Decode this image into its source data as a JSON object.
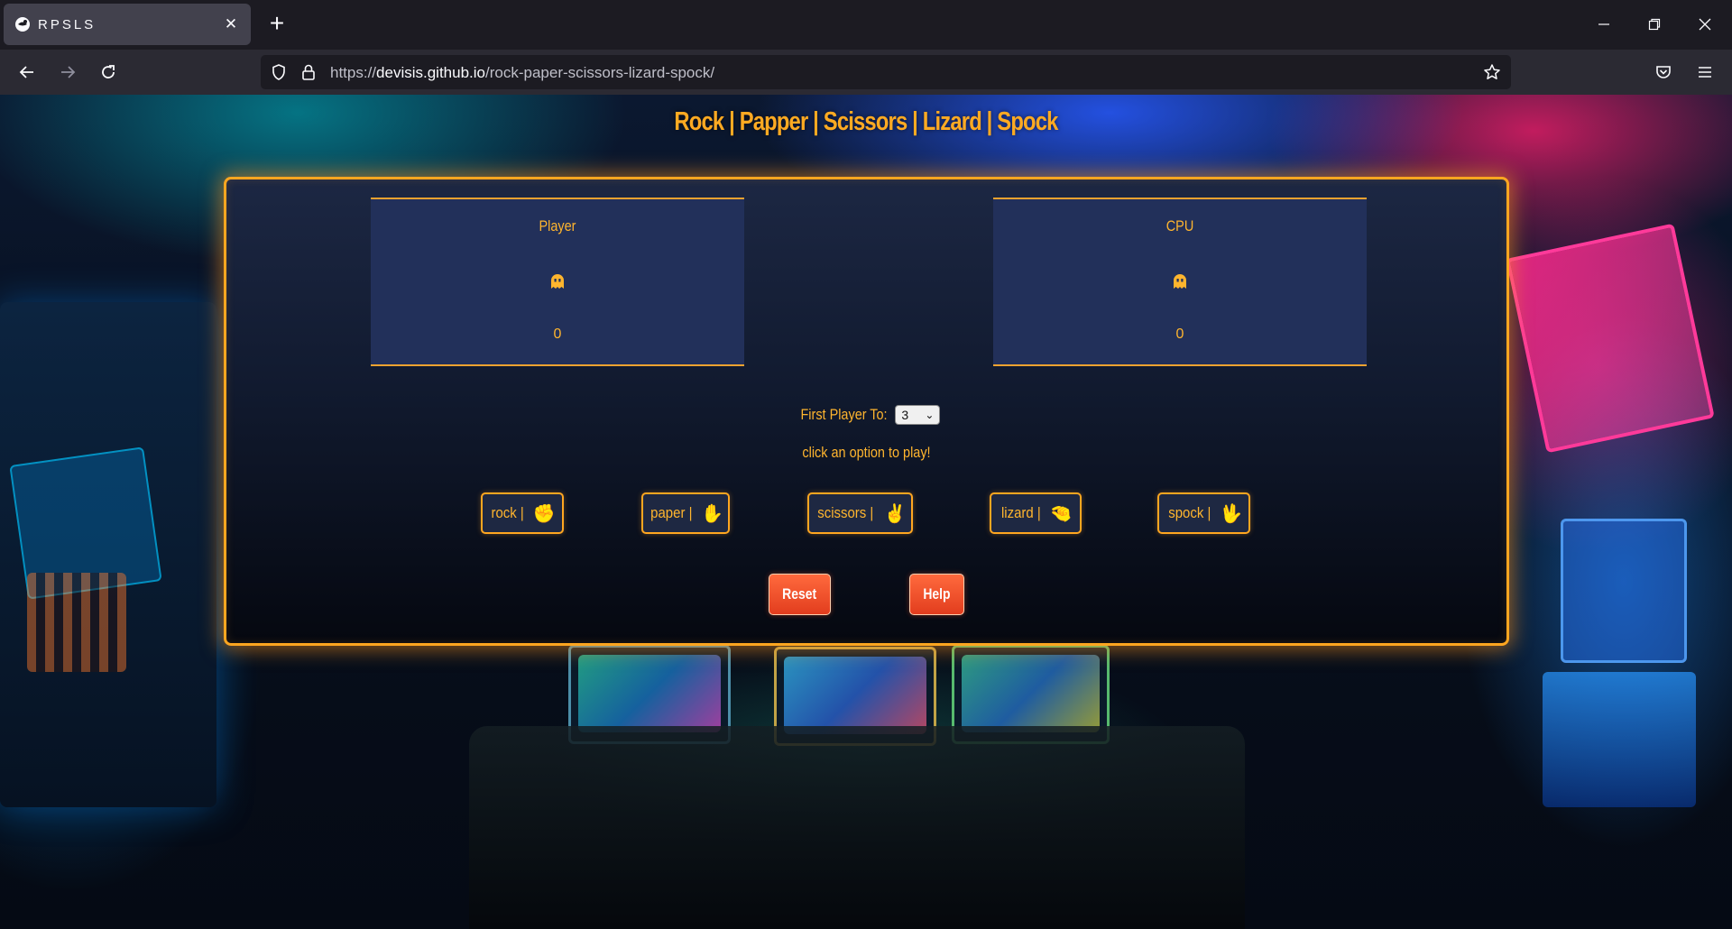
{
  "browser": {
    "tab_title": "RPSLS",
    "url_prefix": "https://",
    "url_host": "devisis.github.io",
    "url_path": "/rock-paper-scissors-lizard-spock/"
  },
  "game": {
    "title": "Rock | Papper | Scissors | Lizard | Spock",
    "player": {
      "label": "Player",
      "score": "0"
    },
    "cpu": {
      "label": "CPU",
      "score": "0"
    },
    "first_to_label": "First Player To:",
    "first_to_value": "3",
    "instructions": "click an option to play!",
    "choices": [
      {
        "label": "rock |",
        "icon": "✊"
      },
      {
        "label": "paper |",
        "icon": "✋"
      },
      {
        "label": "scissors |",
        "icon": "✌"
      },
      {
        "label": "lizard |",
        "icon": "🤏"
      },
      {
        "label": "spock |",
        "icon": "🖖"
      }
    ],
    "reset_label": "Reset",
    "help_label": "Help",
    "accent_color": "#ffa620"
  }
}
